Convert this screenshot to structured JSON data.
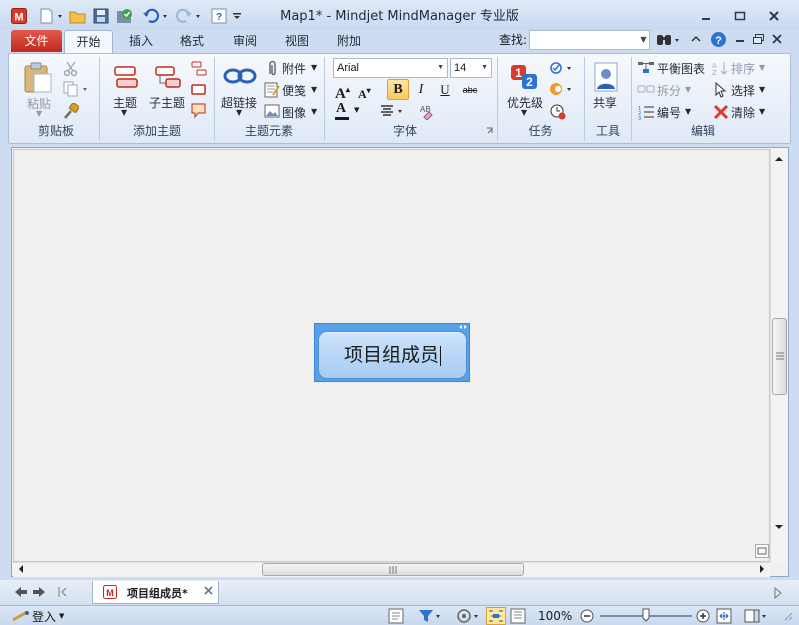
{
  "window": {
    "title": "Map1* - Mindjet MindManager 专业版"
  },
  "tabs": {
    "file": "文件",
    "items": [
      "开始",
      "插入",
      "格式",
      "审阅",
      "视图",
      "附加"
    ],
    "active": "开始"
  },
  "search": {
    "label": "查找:",
    "value": ""
  },
  "ribbon": {
    "clipboard": {
      "group_label": "剪贴板",
      "paste_label": "粘贴"
    },
    "add_topic": {
      "group_label": "添加主题",
      "topic_label": "主题",
      "subtopic_label": "子主题"
    },
    "topic_elements": {
      "group_label": "主题元素",
      "hyperlink_label": "超链接",
      "attachment_label": "附件",
      "notes_label": "便笺",
      "image_label": "图像"
    },
    "font": {
      "group_label": "字体",
      "family": "Arial",
      "size": "14",
      "bold": "B",
      "italic": "I",
      "underline": "U",
      "strike": "abc",
      "grow": "A",
      "shrink": "A",
      "color": "A"
    },
    "tasks": {
      "group_label": "任务",
      "priority_label": "优先级"
    },
    "tools": {
      "group_label": "工具",
      "share_label": "共享"
    },
    "edit": {
      "group_label": "编辑",
      "balance_label": "平衡图表",
      "split_label": "拆分",
      "numbering_label": "编号",
      "sort_label": "排序",
      "select_label": "选择",
      "clear_label": "清除"
    }
  },
  "map": {
    "central_topic": "项目组成员"
  },
  "doc_tab": {
    "label": "项目组成员*"
  },
  "status": {
    "login_label": "登入",
    "zoom": "100%",
    "zoom_level_fraction": 0.5
  },
  "colors": {
    "accent": "#c4281c",
    "topic_fill": "#a6ccf2",
    "selection": "#56a1ea"
  }
}
